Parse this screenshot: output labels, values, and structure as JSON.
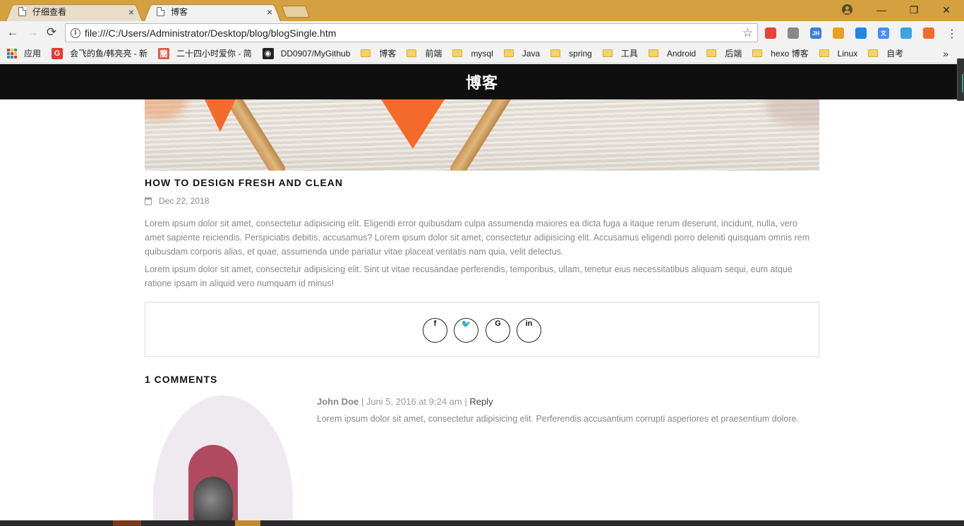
{
  "browser": {
    "tabs": [
      {
        "title": "仔细查看",
        "close": "×",
        "active": false
      },
      {
        "title": "博客",
        "close": "×",
        "active": true
      }
    ],
    "window_controls": {
      "minimize": "—",
      "restore": "❐",
      "close": "✕"
    },
    "nav": {
      "back": "←",
      "forward": "→",
      "reload": "⟳"
    },
    "address_bar": {
      "url": "file:///C:/Users/Administrator/Desktop/blog/blogSingle.htm",
      "info": "i",
      "star": "☆"
    },
    "extensions": [
      {
        "icon": "chrome-icon",
        "text": "",
        "color": "#ea4335"
      },
      {
        "icon": "download-icon",
        "text": "",
        "color": "#888888"
      },
      {
        "icon": "jh-icon",
        "text": "JH",
        "color": "#3b7fd4"
      },
      {
        "icon": "color-picker-icon",
        "text": "",
        "color": "#e8a020"
      },
      {
        "icon": "pocket-icon",
        "text": "",
        "color": "#1e88e5"
      },
      {
        "icon": "translate-icon",
        "text": "文",
        "color": "#4a8af4"
      },
      {
        "icon": "cube-icon",
        "text": "",
        "color": "#3ba3e0"
      },
      {
        "icon": "firefox-icon",
        "text": "",
        "color": "#f06a2a"
      }
    ],
    "menu": "⋮",
    "bookmarks": [
      {
        "label": "应用",
        "type": "apps"
      },
      {
        "label": "会飞的鱼/韩亮亮 - 新",
        "type": "favicon",
        "glyph": "G",
        "color": "#e53935"
      },
      {
        "label": "二十四小时爱你 - 简",
        "type": "favicon",
        "glyph": "簡",
        "color": "#e05a4a"
      },
      {
        "label": "DD0907/MyGithub",
        "type": "favicon",
        "glyph": "◉",
        "color": "#222222"
      },
      {
        "label": "博客",
        "type": "folder"
      },
      {
        "label": "前端",
        "type": "folder"
      },
      {
        "label": "mysql",
        "type": "folder"
      },
      {
        "label": "Java",
        "type": "folder"
      },
      {
        "label": "spring",
        "type": "folder"
      },
      {
        "label": "工具",
        "type": "folder"
      },
      {
        "label": "Android",
        "type": "folder"
      },
      {
        "label": "后端",
        "type": "folder"
      },
      {
        "label": "hexo 博客",
        "type": "folder"
      },
      {
        "label": "Linux",
        "type": "folder"
      },
      {
        "label": "自考",
        "type": "folder"
      }
    ],
    "bookmarks_more": "»"
  },
  "site": {
    "header_title": "博客"
  },
  "post": {
    "title": "HOW TO DESIGN FRESH AND CLEAN",
    "date": "Dec 22, 2018",
    "paragraphs": [
      "Lorem ipsum dolor sit amet, consectetur adipisicing elit. Eligendi error quibusdam culpa assumenda maiores ea dicta fuga a itaque rerum deserunt, incidunt, nulla, vero amet sapiente reiciendis. Perspiciatis debitis, accusamus? Lorem ipsum dolor sit amet, consectetur adipisicing elit. Accusamus eligendi porro deleniti quisquam omnis rem quibusdam corporis alias, et quae, assumenda unde pariatur vitae placeat veritatis nam quia, velit delectus.",
      "Lorem ipsum dolor sit amet, consectetur adipisicing elit. Sint ut vitae recusandae perferendis, temporibus, ullam, tenetur eius necessitatibus aliquam sequi, eum atque ratione ipsam in aliquid vero numquam id minus!"
    ],
    "share": [
      {
        "name": "share-facebook-icon",
        "glyph": "f"
      },
      {
        "name": "share-twitter-icon",
        "glyph": "🐦"
      },
      {
        "name": "share-google-icon",
        "glyph": "G"
      },
      {
        "name": "share-linkedin-icon",
        "glyph": "in"
      }
    ]
  },
  "comments": {
    "title": "1 COMMENTS",
    "items": [
      {
        "author": "John Doe",
        "sep1": " | ",
        "date": "Juni 5, 2016 at 9:24 am",
        "sep2": " | ",
        "reply": "Reply",
        "text": "Lorem ipsum dolor sit amet, consectetur adipisicing elit. Perferendis accusantium corrupti asperiores et praesentium dolore."
      }
    ]
  }
}
